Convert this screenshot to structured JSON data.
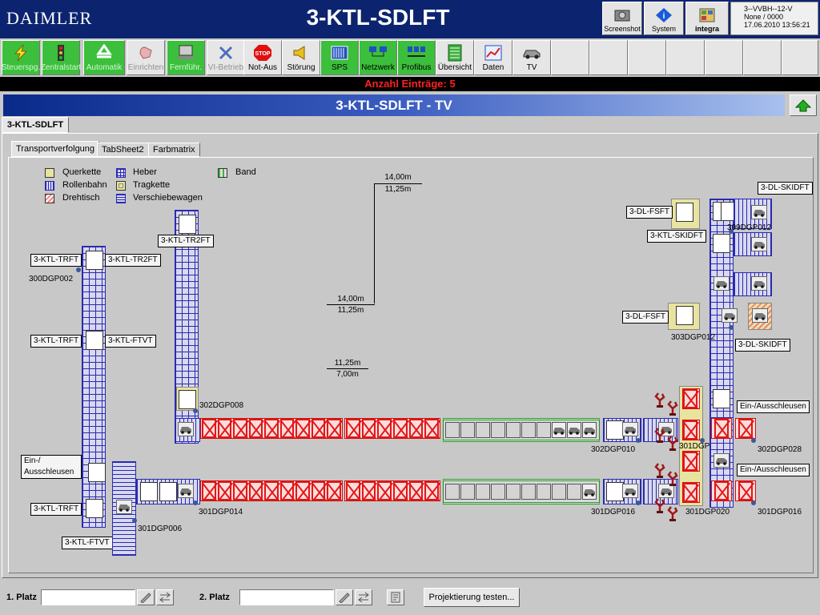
{
  "header": {
    "logo": "DAIMLER",
    "title": "3-KTL-SDLFT",
    "buttons": [
      {
        "label": "Screenshot",
        "icon": "camera-icon"
      },
      {
        "label": "System",
        "icon": "info-icon"
      },
      {
        "label": "integra",
        "icon": "integra-icon"
      }
    ],
    "info": {
      "line1": "3--VVBH--12-V",
      "line2": "None / 0000",
      "line3": "17.06.2010 13:56:21"
    }
  },
  "toolbar": {
    "buttons": [
      {
        "label": "Steuerspg.",
        "icon": "lightning-icon"
      },
      {
        "label": "Zentralstart",
        "icon": "traffic-light-icon"
      },
      {
        "label": "Automatik",
        "icon": "recycle-icon"
      },
      {
        "label": "Einrichten",
        "icon": "hand-icon"
      },
      {
        "label": "Fernführ.",
        "icon": "remote-icon"
      },
      {
        "label": "VI-Betrieb",
        "icon": "wrench-icon"
      },
      {
        "label": "Not-Aus",
        "icon": "stop-icon"
      },
      {
        "label": "Störung",
        "icon": "horn-icon"
      },
      {
        "label": "SPS",
        "icon": "plc-icon"
      },
      {
        "label": "Netzwerk",
        "icon": "network-icon"
      },
      {
        "label": "Profibus",
        "icon": "profibus-icon"
      },
      {
        "label": "Übersicht",
        "icon": "overview-icon"
      },
      {
        "label": "Daten",
        "icon": "chart-icon"
      },
      {
        "label": "TV",
        "icon": "car-icon"
      }
    ]
  },
  "count_text": "Anzahl Einträge: 5",
  "section_title": "3-KTL-SDLFT - TV",
  "outer_tab": "3-KTL-SDLFT",
  "inner_tabs": [
    "Transportverfolgung",
    "TabSheet2",
    "Farbmatrix"
  ],
  "legend": [
    {
      "label": "Querkette",
      "color": "#e8e4a0"
    },
    {
      "label": "Heber",
      "color": "#3838b8"
    },
    {
      "label": "Band",
      "color": "#40b040"
    },
    {
      "label": "Rollenbahn",
      "color": "#3838b8"
    },
    {
      "label": "Tragkette",
      "color": "#e8e4a0"
    },
    {
      "label": "Drehtisch",
      "color": "#f08080"
    },
    {
      "label": "Verschiebewagen",
      "color": "#3838b8"
    }
  ],
  "measurements": [
    [
      "14,00m",
      "11,25m"
    ],
    [
      "14,00m",
      "11,25m"
    ],
    [
      "11,25m",
      "7,00m"
    ]
  ],
  "tags": {
    "trft1": "3-KTL-TRFT",
    "tr2ft1": "3-KTL-TR2FT",
    "trft2": "3-KTL-TRFT",
    "ftvt1": "3-KTL-FTVT",
    "tr2ft2": "3-KTL-TR2FT",
    "einaus": "Ein-/ Ausschleusen",
    "trft3": "3-KTL-TRFT",
    "ftvt2": "3-KTL-FTVT",
    "dlskidft1": "3-DL-SKIDFT",
    "dlfsft1": "3-DL-FSFT",
    "ktlskidft": "3-KTL-SKIDFT",
    "dlfsft2": "3-DL-FSFT",
    "dlskidft2": "3-DL-SKIDFT",
    "einaus2": "Ein-/Ausschleusen",
    "einaus3": "Ein-/Ausschleusen"
  },
  "labels": {
    "l300dgp002": "300DGP002",
    "l302dgp008": "302DGP008",
    "l301dgp006": "301DGP006",
    "l301dgp014": "301DGP014",
    "l302dgp010": "302DGP010",
    "l301dgp016a": "301DGP016",
    "l301dgp020a": "301DGP020",
    "l301dgp020b": "301DGP020",
    "l302dgp028": "302DGP028",
    "l301dgp016b": "301DGP016",
    "l309dgp012": "309DGP012",
    "l303dgp012": "303DGP012"
  },
  "bottom": {
    "platz1": "1. Platz",
    "platz2": "2. Platz",
    "platz1_value": "",
    "platz2_value": "",
    "test_button": "Projektierung testen..."
  }
}
